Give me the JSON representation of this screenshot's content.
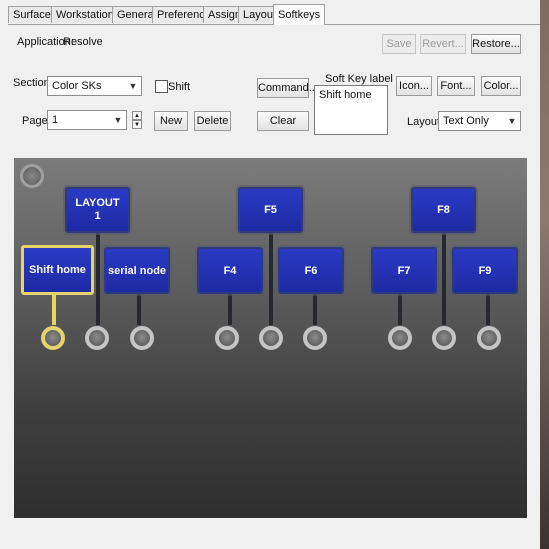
{
  "tabs": [
    "Surfaces",
    "Workstations",
    "General",
    "Preferences",
    "Assign",
    "Layouts",
    "Softkeys"
  ],
  "active_tab": "Softkeys",
  "application": {
    "label": "Application:",
    "value": "Resolve"
  },
  "top_buttons": {
    "save": "Save",
    "revert": "Revert...",
    "restore": "Restore..."
  },
  "section": {
    "label": "Section:",
    "value": "Color SKs"
  },
  "shift": {
    "label": "Shift",
    "checked": false
  },
  "page": {
    "label": "Page:",
    "value": "1"
  },
  "page_buttons": {
    "new": "New",
    "delete": "Delete"
  },
  "command_button": "Command...",
  "clear_button": "Clear",
  "soft_key_label": {
    "title": "Soft Key label",
    "value": "Shift home"
  },
  "style_buttons": {
    "icon": "Icon...",
    "font": "Font...",
    "color": "Color..."
  },
  "layout": {
    "label": "Layout:",
    "value": "Text Only"
  },
  "softkeys": {
    "top": [
      "LAYOUT\n1",
      "F5",
      "F8"
    ],
    "bottom": [
      "Shift home",
      "serial node",
      "F4",
      "F6",
      "F7",
      "F9"
    ],
    "selected": "Shift home"
  },
  "colors": {
    "key_fill": "#1f2eb0",
    "selection": "#e6d36a",
    "panel": "#5a5a5a"
  }
}
